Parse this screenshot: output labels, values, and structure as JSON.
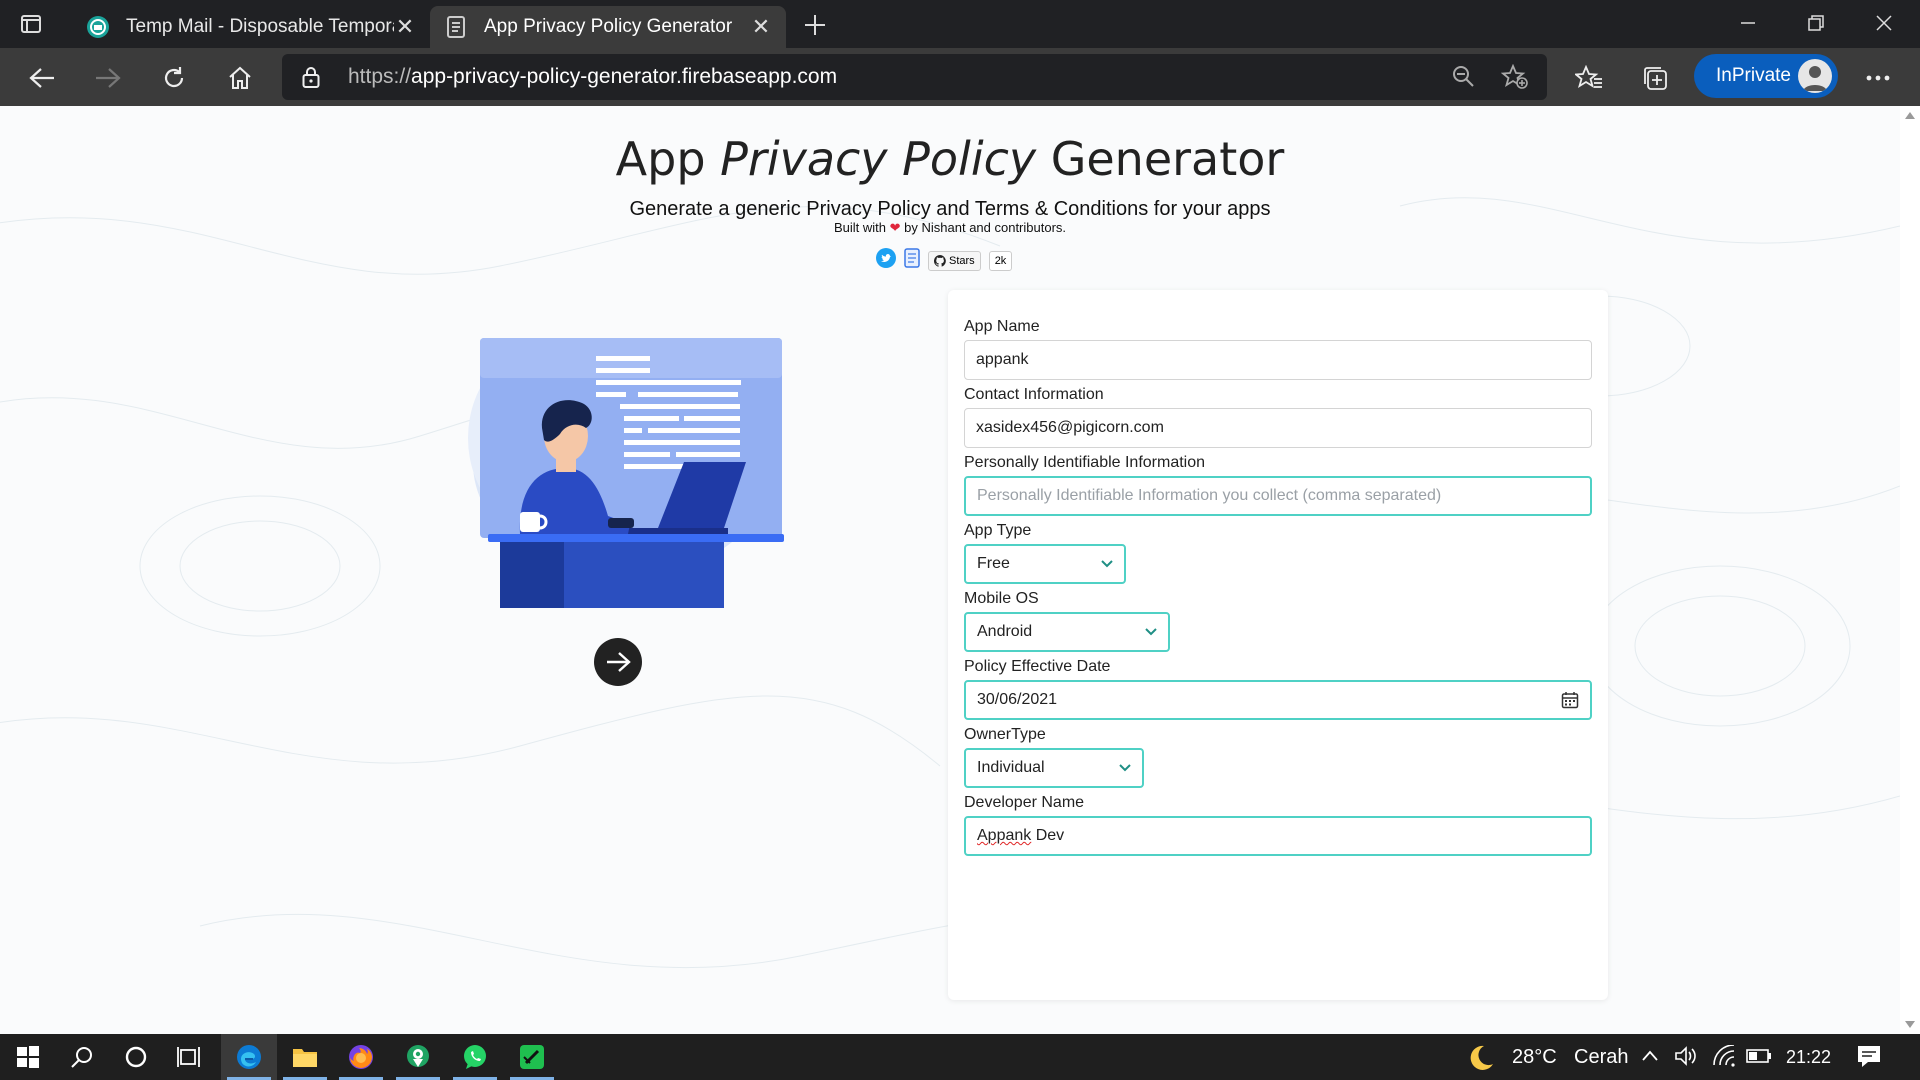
{
  "browser": {
    "tabs": [
      {
        "title": "Temp Mail - Disposable Tempora",
        "active": false,
        "icon": "tempmail-icon"
      },
      {
        "title": "App Privacy Policy Generator",
        "active": true,
        "icon": "document-icon"
      }
    ],
    "url_prefix": "https://",
    "url_host": "app-privacy-policy-generator.firebaseapp.com",
    "inprivate_label": "InPrivate"
  },
  "page": {
    "title_part1": "App ",
    "title_italic": "Privacy Policy",
    "title_part2": " Generator",
    "subtitle": "Generate a generic Privacy Policy and Terms & Conditions for your apps",
    "built_prefix": "Built with",
    "built_suffix": "by Nishant and contributors.",
    "github_stars_label": "Stars",
    "github_stars_count": "2k"
  },
  "form": {
    "app_name": {
      "label": "App Name",
      "value": "appank"
    },
    "contact": {
      "label": "Contact Information",
      "value": "xasidex456@pigicorn.com"
    },
    "pii": {
      "label": "Personally Identifiable Information",
      "placeholder": "Personally Identifiable Information you collect (comma separated)"
    },
    "app_type": {
      "label": "App Type",
      "value": "Free"
    },
    "mobile_os": {
      "label": "Mobile OS",
      "value": "Android"
    },
    "effective_date": {
      "label": "Policy Effective Date",
      "value": "30/06/2021"
    },
    "owner_type": {
      "label": "OwnerType",
      "value": "Individual"
    },
    "developer_name": {
      "label": "Developer Name",
      "value_misspelled": "Appank",
      "value_rest": " Dev"
    }
  },
  "taskbar": {
    "weather_temp": "28°C",
    "weather_text": "Cerah",
    "time": "21:22"
  },
  "colors": {
    "accent_teal": "#4fd1c5",
    "inprivate_blue": "#0a5ebd",
    "illustration_blue": "#3a6cf4"
  }
}
